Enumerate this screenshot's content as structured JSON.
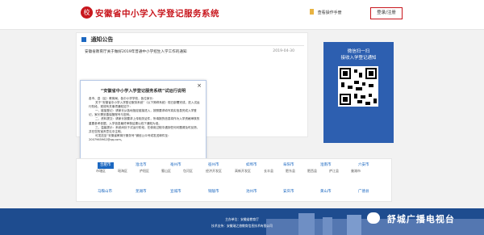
{
  "header": {
    "title": "安徽省中小学入学登记服务系统",
    "manual_link": "查看操作手册",
    "login_button": "登录/注册"
  },
  "notice": {
    "header": "通知公告",
    "items": [
      {
        "title": "安徽省教育厅关于做好2019年普通中小学招生入学工作的通知",
        "date": "2019-04-30"
      }
    ]
  },
  "qr": {
    "title": "微信扫一扫",
    "subtitle": "接收入学登记通知"
  },
  "modal": {
    "title": "“安徽省中小学入学登记服务系统”试运行说明",
    "paragraphs": [
      "各市、县（区）教育局，各中小学学校，各位家长：",
      "关于“安徽省中小学入学登记服务系统”（以下简称系统）现已部署完成，进入试运行阶段，现将有关事项通知如下：",
      "一、链接登记：请家长从各地指定链接进入，按照要求填写真实信息完成入学登记，家长需妥善保管账号与密码。",
      "二、资料提交：请家长按要求上传相关证件，所填报的信息将作为入学资格审核的重要参考依据，入学信息最终审核结果以线下通知为准。",
      "三、温馨提示：系统尚处于试运行阶段，在使用过程中遇到任何问题请及时反馈，并在您的宝贵意见中注明。",
      "可发送至“安徽省教育厅服务号”微信公众号或发送邮件至："
    ],
    "email": "2007965962@qq.com。"
  },
  "cities": {
    "row1": [
      "合肥市",
      "淮北市",
      "亳州市",
      "宿州市",
      "蚌埠市",
      "阜阳市",
      "淮南市",
      "六安市"
    ],
    "counties": [
      "市辖区",
      "瑶海区",
      "庐阳区",
      "蜀山区",
      "包河区",
      "经济开发区",
      "高新开发区",
      "长丰县",
      "肥东县",
      "肥西县",
      "庐江县",
      "巢湖市"
    ],
    "row2": [
      "马鞍山市",
      "芜湖市",
      "宣城市",
      "铜陵市",
      "池州市",
      "安庆市",
      "黄山市",
      "广德县"
    ]
  },
  "footer": {
    "sponsor": "主办单位：安徽省教育厅",
    "tech": "技术支持：安徽瑞之旅教育信息技术有限公司"
  },
  "watermark": "舒城广播电视台",
  "colors": {
    "brand_red": "#c8161d",
    "link_blue": "#1c68c1",
    "qr_panel_blue": "#2d5fb0",
    "footer_blue": "#1e4c8f"
  }
}
